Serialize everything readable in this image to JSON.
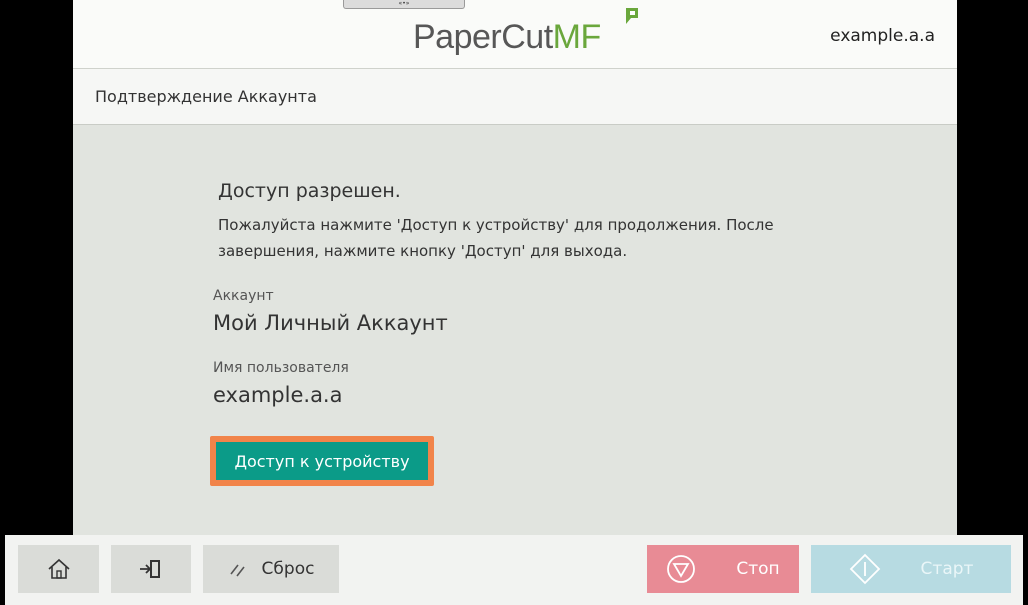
{
  "header": {
    "logo_part1": "PaperCut",
    "logo_part2": "MF",
    "user_id": "example.a.a"
  },
  "subheader": {
    "title": "Подтверждение Аккаунта"
  },
  "main": {
    "status_title": "Доступ разрешен.",
    "instruction": "Пожалуйста нажмите 'Доступ к устройству' для продолжения. После завершения, нажмите кнопку 'Доступ' для выхода.",
    "account_label": "Аккаунт",
    "account_value": "Мой Личный Аккаунт",
    "username_label": "Имя пользователя",
    "username_value": "example.a.a",
    "access_button": "Доступ к устройству"
  },
  "bottombar": {
    "reset_label": "Сброс",
    "stop_label": "Стоп",
    "start_label": "Старт"
  },
  "colors": {
    "accent_green": "#0b9b88",
    "focus_orange": "#f1844a",
    "stop_pink": "#e88b95",
    "start_blue": "#b7dbe2",
    "logo_green": "#6aa73c"
  },
  "icons": [
    "home-icon",
    "logout-icon",
    "reset-slash-icon",
    "stop-icon",
    "start-diamond-icon",
    "leaf-icon"
  ]
}
